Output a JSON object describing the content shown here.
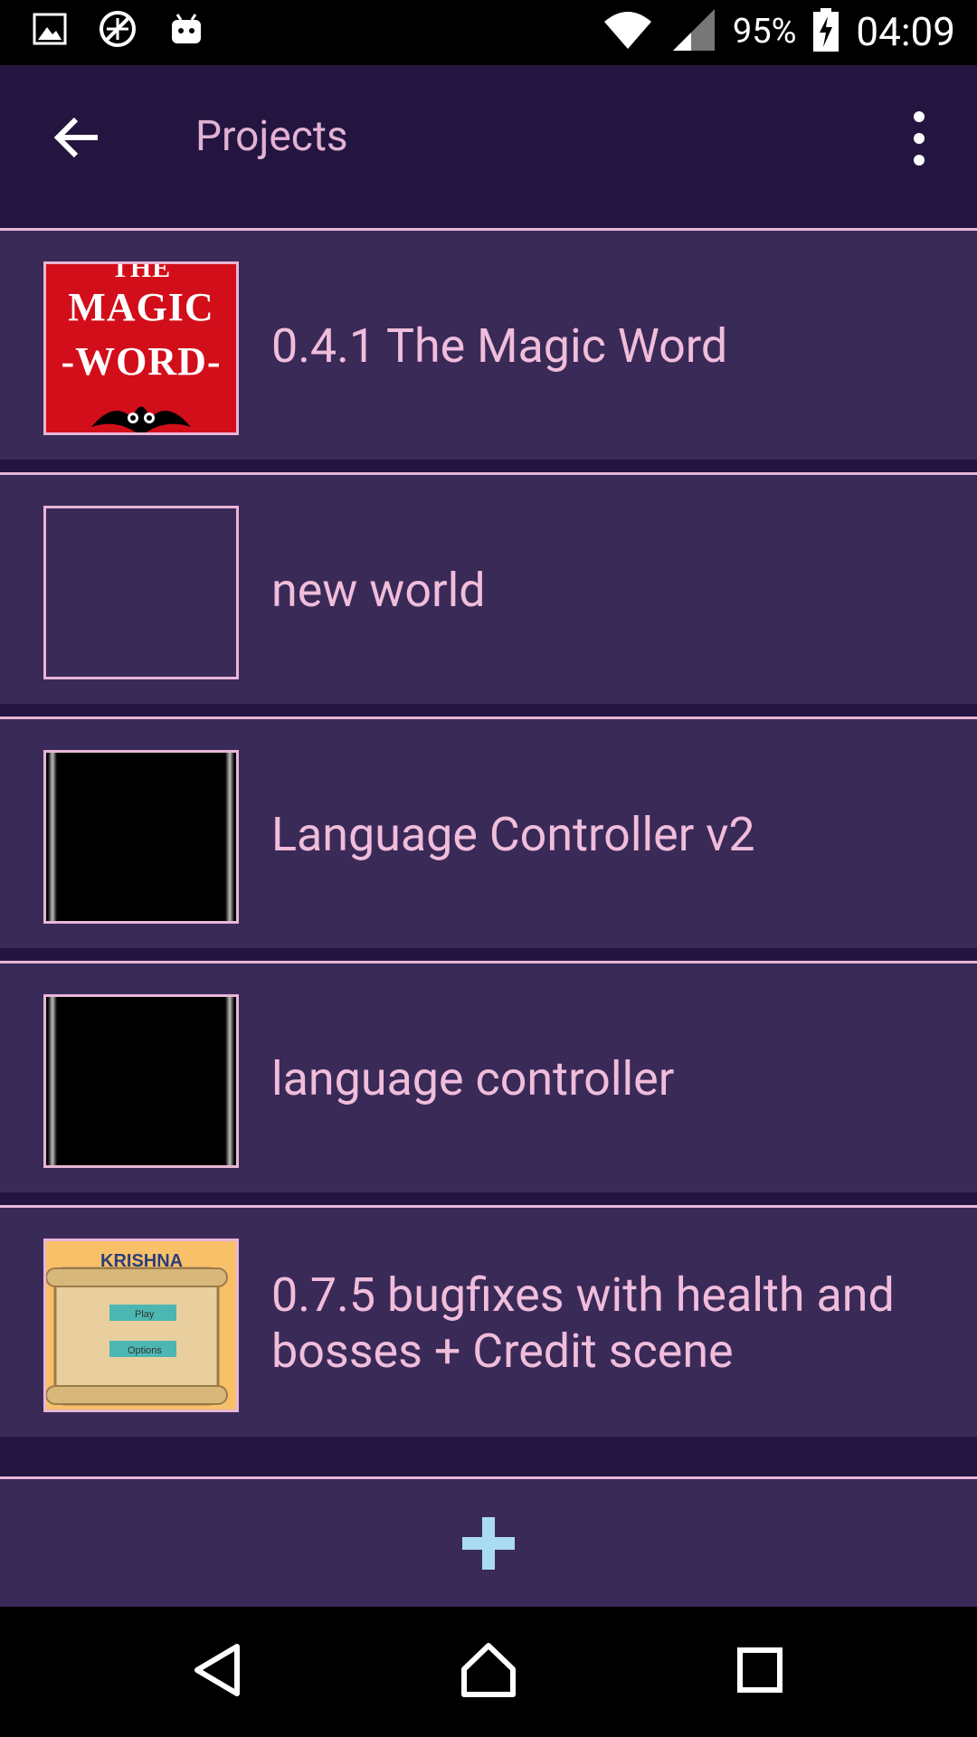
{
  "status_bar": {
    "battery_percent": "95%",
    "time": "04:09",
    "icons": [
      "image-icon",
      "no-sync-icon",
      "android-icon",
      "wifi-icon",
      "signal-icon",
      "battery-charging-icon"
    ]
  },
  "app_bar": {
    "title": "Projects",
    "back_icon": "arrow-left-icon",
    "menu_icon": "more-vert-icon"
  },
  "projects": [
    {
      "label": "0.4.1 The Magic Word",
      "thumbnail": "magic-word-thumbnail",
      "thumb_text_lines": [
        "MAGIC",
        "-WORD-"
      ]
    },
    {
      "label": "new world",
      "thumbnail": "empty-thumbnail"
    },
    {
      "label": "Language Controller v2",
      "thumbnail": "black-thumbnail"
    },
    {
      "label": "language controller",
      "thumbnail": "black-thumbnail"
    },
    {
      "label": "0.7.5  bugfixes with health and bosses + Credit scene",
      "thumbnail": "krishna-thumbnail",
      "thumb_text_lines": [
        "KRISHNA",
        "Play",
        "Options"
      ]
    }
  ],
  "add_button": {
    "icon": "plus-icon"
  },
  "nav_bar": {
    "icons": [
      "back-triangle-icon",
      "home-icon",
      "recents-icon"
    ]
  },
  "colors": {
    "background": "#2a1a40",
    "row_bg": "#3a2a58",
    "accent_text": "#f0bddb",
    "plus": "#a9dbf2"
  }
}
